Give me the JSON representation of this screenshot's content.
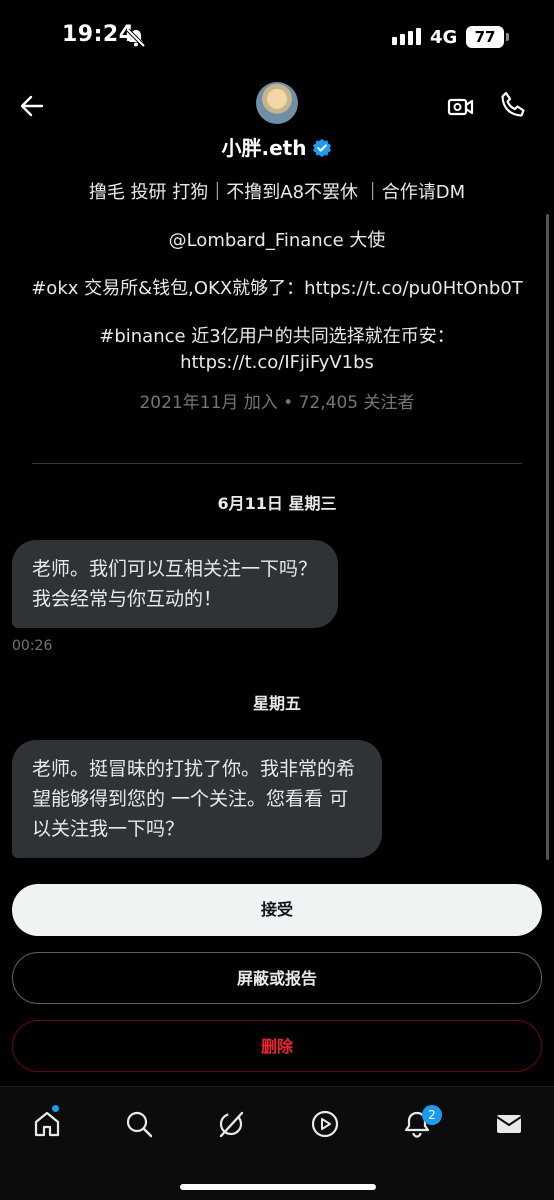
{
  "status_bar": {
    "time": "19:24",
    "network": "4G",
    "battery": "77"
  },
  "header": {
    "name": "小胖.eth"
  },
  "bio": {
    "line1": "撸毛 投研 打狗｜不撸到A8不罢休 ｜合作请DM",
    "line2": "@Lombard_Finance 大使",
    "line3": "#okx 交易所&钱包,OKX就够了：https://t.co/pu0HtOnb0T",
    "line4": "#binance 近3亿用户的共同选择就在币安：https://t.co/IFjiFyV1bs",
    "meta": "2021年11月 加入 • 72,405 关注者"
  },
  "conversation": {
    "date1": "6月11日 星期三",
    "msg1": "老师。我们可以互相关注一下吗？ 我会经常与你互动的！",
    "msg1_time": "00:26",
    "date2": "星期五",
    "msg2": "老师。挺冒昧的打扰了你。我非常的希望能够得到您的 一个关注。您看看 可以关注我一下吗？"
  },
  "actions": {
    "accept": "接受",
    "block_report": "屏蔽或报告",
    "delete": "删除"
  },
  "bottom_nav": {
    "items": [
      "home-icon",
      "search-icon",
      "grok-icon",
      "video-icon",
      "notifications-icon",
      "messages-icon"
    ],
    "notifications_count": "2"
  },
  "colors": {
    "accent": "#1d9bf0",
    "danger": "#f4212e",
    "bubble": "#2f3336"
  }
}
